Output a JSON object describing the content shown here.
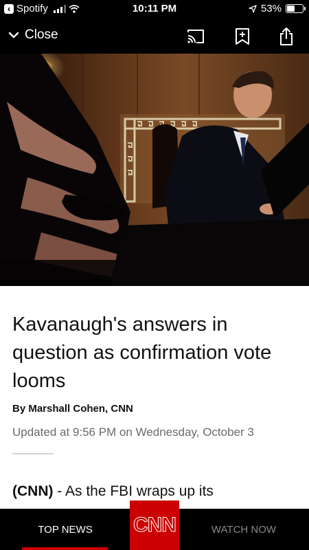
{
  "status_bar": {
    "back_app": "Spotify",
    "time": "10:11 PM",
    "battery": "53%",
    "battery_level": 0.53,
    "icons": [
      "back-arrow-icon",
      "signal-icon",
      "wifi-icon",
      "location-arrow-icon",
      "battery-icon"
    ]
  },
  "nav": {
    "close_label": "Close",
    "icons": [
      "chevron-down-icon",
      "cast-icon",
      "bookmark-icon",
      "share-icon"
    ]
  },
  "article": {
    "headline": "Kavanaugh's answers in question as confirmation vote looms",
    "byline": "By Marshall Cohen, CNN",
    "updated": "Updated at 9:56 PM on Wednesday, October 3",
    "lead_source": "(CNN)",
    "lead_text": " - As the FBI wraps up its"
  },
  "tabs": {
    "top_news": "TOP NEWS",
    "logo": "CNN",
    "watch_now": "WATCH NOW"
  },
  "colors": {
    "brand_red": "#cc0000",
    "inactive_tab": "#8a8a8a",
    "meta_gray": "#6a6a6a"
  }
}
